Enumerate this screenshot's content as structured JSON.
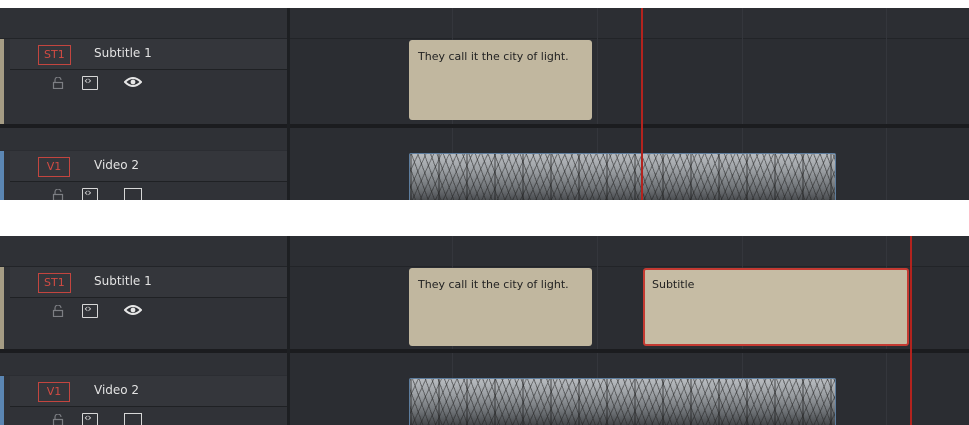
{
  "panels": [
    {
      "subtitle_track": {
        "tag": "ST1",
        "name": "Subtitle 1"
      },
      "video_track": {
        "tag": "V1",
        "name": "Video 2"
      },
      "clips": [
        {
          "text": "They call it the city of light.",
          "selected": false
        }
      ]
    },
    {
      "subtitle_track": {
        "tag": "ST1",
        "name": "Subtitle 1"
      },
      "video_track": {
        "tag": "V1",
        "name": "Video 2"
      },
      "clips": [
        {
          "text": "They call it the city of light.",
          "selected": false
        },
        {
          "text": "Subtitle",
          "selected": true
        }
      ]
    }
  ],
  "colors": {
    "playhead": "#b3231e",
    "subtitle_clip": "#c1b79f",
    "selected_border": "#c43a32",
    "track_tag": "#c3453f"
  },
  "icons": [
    "lock-icon",
    "code-icon",
    "eye-icon",
    "film-icon"
  ]
}
